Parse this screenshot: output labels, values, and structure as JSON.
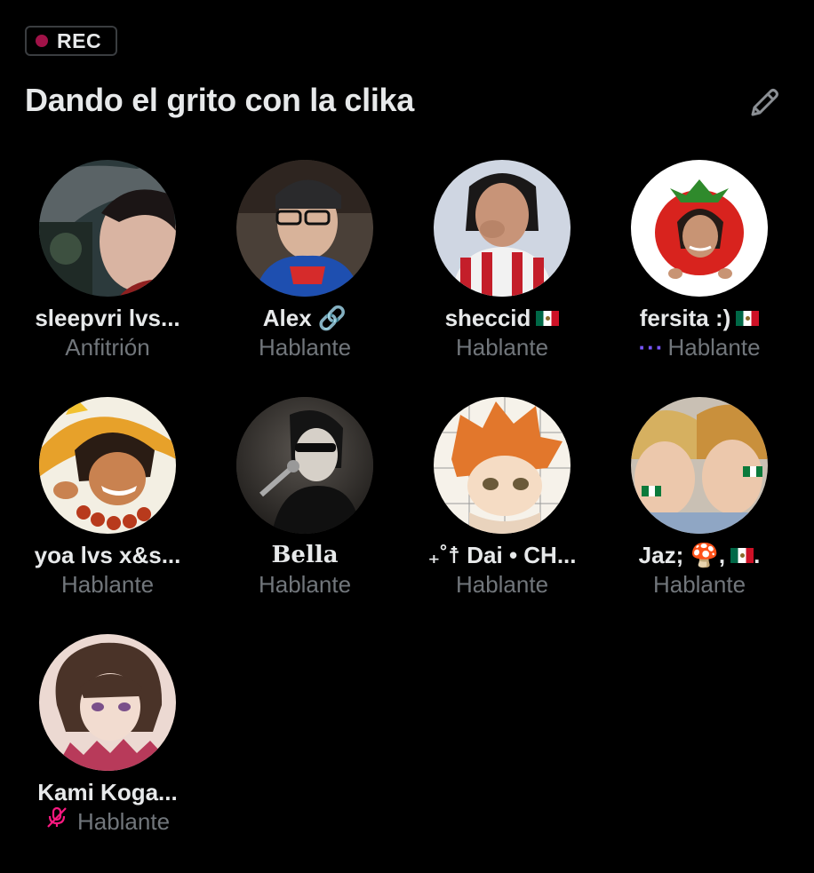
{
  "rec": {
    "label": "REC"
  },
  "space": {
    "title": "Dando el grito con la clika"
  },
  "icons": {
    "edit": "pencil-icon",
    "mute": "microphone-muted-icon"
  },
  "colors": {
    "rec_dot": "#a11248",
    "speaking_dots": "#7856ff",
    "muted": "#f91880",
    "secondary_text": "#71767b"
  },
  "participants": [
    {
      "name": "sleepvri lvs...",
      "role": "Anfitrión"
    },
    {
      "name": "Alex 🔗",
      "role": "Hablante"
    },
    {
      "name": "sheccid",
      "role": "Hablante",
      "flag": "mexico-flag"
    },
    {
      "name": "fersita :)",
      "role": "Hablante",
      "flag": "mexico-flag",
      "speaking": "···"
    },
    {
      "name": "yoa lvs x&s...",
      "role": "Hablante"
    },
    {
      "name": "Bella",
      "role": "Hablante"
    },
    {
      "name": "₊˚☨ Dai • CH...",
      "role": "Hablante"
    },
    {
      "name": "Jaz; 🍄,",
      "name_suffix": ".",
      "role": "Hablante",
      "flag": "mexico-flag"
    },
    {
      "name": "Kami Koga...",
      "role": "Hablante",
      "muted": true
    }
  ]
}
